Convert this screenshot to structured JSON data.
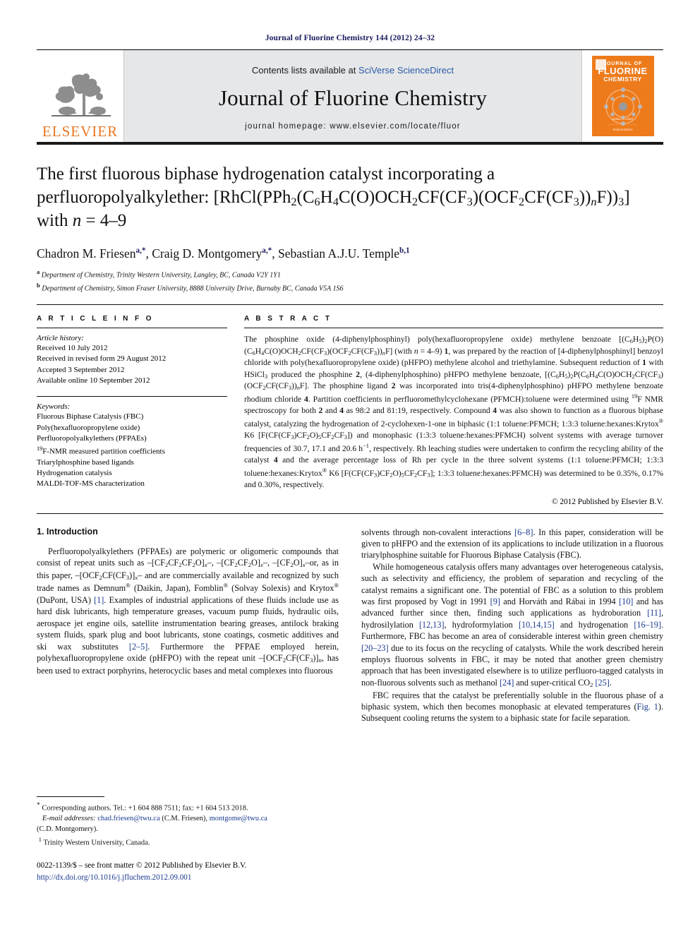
{
  "running_head": "Journal of Fluorine Chemistry 144 (2012) 24–32",
  "masthead": {
    "contents_prefix": "Contents lists available at ",
    "contents_link": "SciVerse ScienceDirect",
    "journal_name": "Journal of Fluorine Chemistry",
    "homepage": "journal homepage: www.elsevier.com/locate/fluor",
    "publisher_wordmark": "ELSEVIER",
    "cover": {
      "line1": "JOURNAL OF",
      "line2": "FLUORINE",
      "line3": "CHEMISTRY",
      "footer1": "Editor-in-Chief",
      "footer2": "···························",
      "footer3": "ScienceDirect"
    },
    "colors": {
      "accent_orange": "#E87722",
      "link_blue": "#2b5ca8",
      "band": "#e6e7e9"
    }
  },
  "title": {
    "line1": "The first fluorous biphase hydrogenation catalyst incorporating a",
    "line2_pre": "perfluoropolyalkylether: [RhCl(PPh",
    "full_plain": "The first fluorous biphase hydrogenation catalyst incorporating a perfluoropolyalkylether: [RhCl(PPh2(C6H4C(O)OCH2CF(CF3)(OCF2CF(CF3))nF))3] with n = 4–9"
  },
  "authors": {
    "a1": "Chadron M. Friesen",
    "a1_sup": "a,*",
    "a2": "Craig D. Montgomery",
    "a2_sup": "a,*",
    "a3": "Sebastian A.J.U. Temple",
    "a3_sup": "b,1",
    "affiliations": [
      {
        "marker": "a",
        "text": "Department of Chemistry, Trinity Western University, Langley, BC, Canada V2Y 1Y1"
      },
      {
        "marker": "b",
        "text": "Department of Chemistry, Simon Fraser University, 8888 University Drive, Burnaby BC, Canada V5A 1S6"
      }
    ]
  },
  "article_info": {
    "heading": "A R T I C L E   I N F O",
    "history_label": "Article history:",
    "history": [
      "Received 10 July 2012",
      "Received in revised form 29 August 2012",
      "Accepted 3 September 2012",
      "Available online 10 September 2012"
    ],
    "keywords_label": "Keywords:",
    "keywords": [
      "Fluorous Biphase Catalysis (FBC)",
      "Poly(hexafluoropropylene oxide)",
      "Perfluoropolyalkylethers (PFPAEs)",
      "19F-NMR measured partition coefficients",
      "Triarylphosphine based ligands",
      "Hydrogenation catalysis",
      "MALDI-TOF-MS characterization"
    ]
  },
  "abstract": {
    "heading": "A B S T R A C T",
    "copyright": "© 2012 Published by Elsevier B.V."
  },
  "intro": {
    "heading": "1.  Introduction"
  },
  "footnotes": {
    "corresponding": "Corresponding authors. Tel.: +1 604 888 7511; fax: +1 604 513 2018.",
    "email_label": "E-mail addresses:",
    "email1": "chad.friesen@twu.ca",
    "email1_name": "(C.M. Friesen),",
    "email2": "montgome@twu.ca",
    "email2_name": "(C.D. Montgomery).",
    "fn1_marker": "1",
    "fn1": "Trinity Western University, Canada."
  },
  "imprint": {
    "line": "0022-1139/$ – see front matter © 2012 Published by Elsevier B.V.",
    "doi": "http://dx.doi.org/10.1016/j.jfluchem.2012.09.001"
  }
}
